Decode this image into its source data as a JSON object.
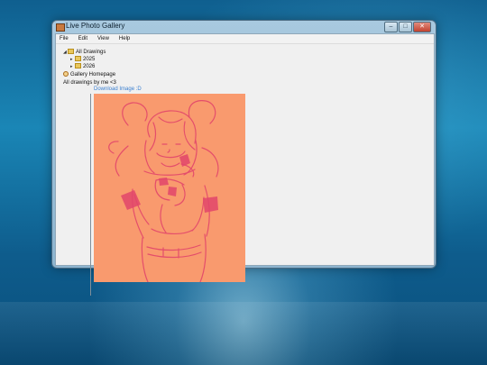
{
  "window": {
    "title": "Live Photo Gallery",
    "caption_buttons": {
      "minimize": "–",
      "maximize": "□",
      "close": "✕"
    }
  },
  "menu": [
    "File",
    "Edit",
    "View",
    "Help"
  ],
  "tree": {
    "root": "All Drawings",
    "children": [
      "2025",
      "2026"
    ],
    "gallery_home": "Gallery Homepage",
    "caption": "All drawings by me <3"
  },
  "download_link": "Download Image :D",
  "colors": {
    "drawing_bg": "#f99a6e",
    "line_art": "#e2466b",
    "link": "#3a7fd0"
  },
  "icons": {
    "app": "app-icon",
    "expander_open": "triangle-down-icon",
    "expander_closed": "triangle-right-icon",
    "folder": "folder-icon",
    "globe": "globe-icon"
  }
}
